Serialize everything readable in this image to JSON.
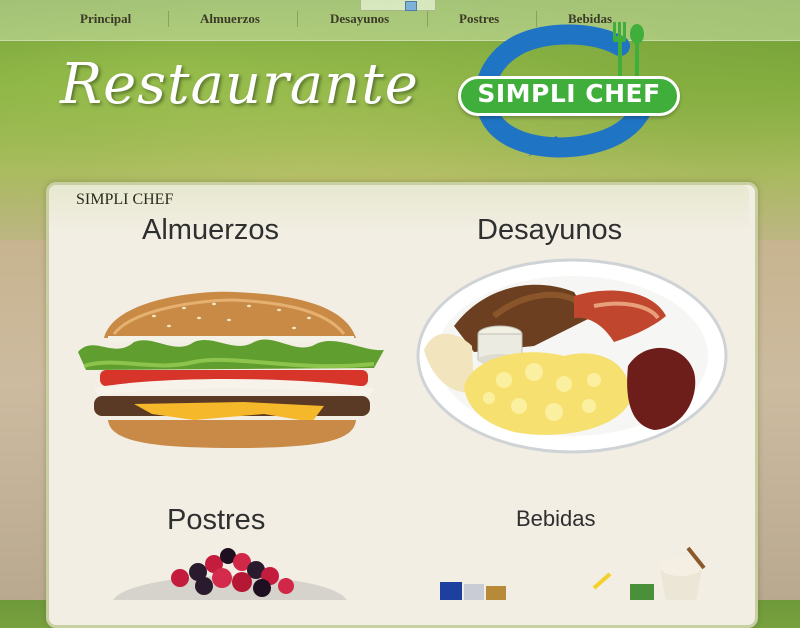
{
  "nav": {
    "items": [
      "Principal",
      "Almuerzos",
      "Desayunos",
      "Postres",
      "Bebidas"
    ]
  },
  "header": {
    "brand_script": "Restaurante",
    "logo_text": "SIMPLI CHEF"
  },
  "panel": {
    "title": "SIMPLI CHEF",
    "categories": [
      {
        "name": "Almuerzos",
        "icon": "burger-image"
      },
      {
        "name": "Desayunos",
        "icon": "breakfast-plate-image"
      },
      {
        "name": "Postres",
        "icon": "berries-dessert-image"
      },
      {
        "name": "Bebidas",
        "icon": "drinks-image"
      }
    ]
  },
  "colors": {
    "logo_blue": "#1f74c4",
    "logo_green": "#3fae3a",
    "header_green": "#7faa3b",
    "panel_bg": "#f2eee4"
  }
}
